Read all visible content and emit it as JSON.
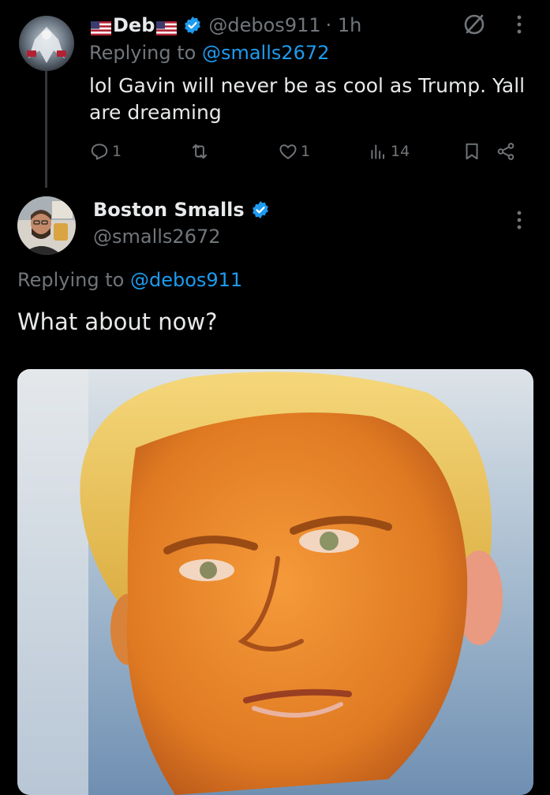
{
  "reply_tweet": {
    "display_name": "Deb",
    "handle": "@debos911",
    "time": "· 1h",
    "replying_prefix": "Replying to",
    "replying_to": "@smalls2672",
    "text": "lol Gavin will never be as cool as Trump. Yall are dreaming",
    "actions": {
      "reply_count": "1",
      "like_count": "1",
      "view_count": "14"
    }
  },
  "main_tweet": {
    "display_name": "Boston Smalls",
    "handle": "@smalls2672",
    "replying_prefix": "Replying to",
    "replying_to": "@debos911",
    "text": "What about now?"
  },
  "colors": {
    "background": "#000000",
    "text": "#e7e9ea",
    "muted": "#71767b",
    "link": "#1d9bf0",
    "verified": "#1d9bf0"
  },
  "icons": [
    "us-flag-icon",
    "verified-badge-icon",
    "grok-icon",
    "more-dots-icon",
    "reply-icon",
    "retweet-icon",
    "like-icon",
    "views-icon",
    "bookmark-icon",
    "share-icon"
  ]
}
